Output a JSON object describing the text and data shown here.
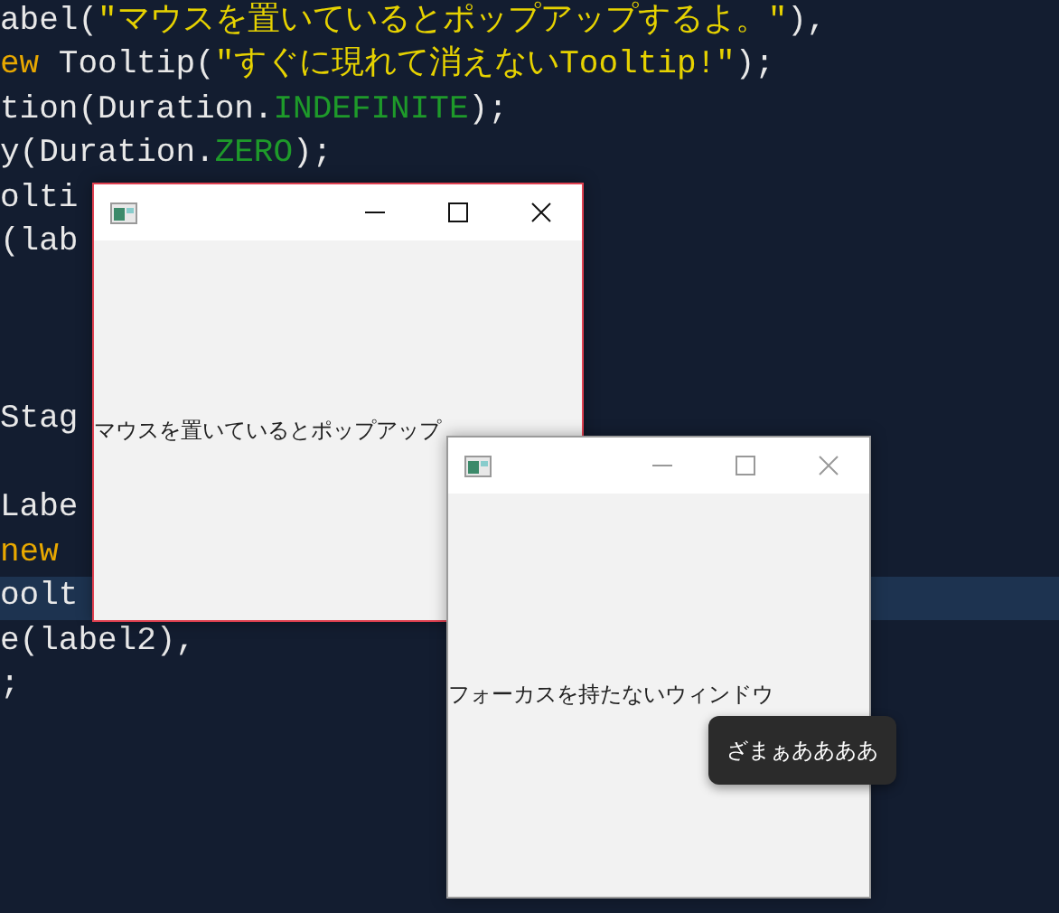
{
  "editor": {
    "lines": [
      {
        "kind": "code",
        "highlighted": false,
        "tokens": [
          {
            "text": "abel(",
            "kind": "plain"
          },
          {
            "text": "\"マウスを置いているとポップアップするよ。\"",
            "kind": "string"
          },
          {
            "text": "),",
            "kind": "plain"
          }
        ]
      },
      {
        "kind": "code",
        "highlighted": false,
        "tokens": [
          {
            "text": "ew",
            "kind": "keyword"
          },
          {
            "text": " Tooltip(",
            "kind": "plain"
          },
          {
            "text": "\"すぐに現れて消えないTooltip!\"",
            "kind": "string"
          },
          {
            "text": ");",
            "kind": "plain"
          }
        ]
      },
      {
        "kind": "code",
        "highlighted": false,
        "tokens": [
          {
            "text": "tion(Duration.",
            "kind": "plain"
          },
          {
            "text": "INDEFINITE",
            "kind": "constant"
          },
          {
            "text": ");",
            "kind": "plain"
          }
        ]
      },
      {
        "kind": "code",
        "highlighted": false,
        "tokens": [
          {
            "text": "y(Duration.",
            "kind": "plain"
          },
          {
            "text": "ZERO",
            "kind": "constant"
          },
          {
            "text": ");",
            "kind": "plain"
          }
        ]
      },
      {
        "kind": "code",
        "highlighted": false,
        "tokens": [
          {
            "text": "olti",
            "kind": "plain"
          }
        ]
      },
      {
        "kind": "code",
        "highlighted": false,
        "tokens": [
          {
            "text": "(lab",
            "kind": "plain"
          }
        ]
      },
      {
        "kind": "blank",
        "highlighted": false
      },
      {
        "kind": "blank",
        "highlighted": false
      },
      {
        "kind": "blank",
        "highlighted": false
      },
      {
        "kind": "code",
        "highlighted": false,
        "tokens": [
          {
            "text": "Stag",
            "kind": "plain"
          }
        ]
      },
      {
        "kind": "blank",
        "highlighted": false
      },
      {
        "kind": "code",
        "highlighted": false,
        "tokens": [
          {
            "text": "Labe",
            "kind": "plain"
          }
        ]
      },
      {
        "kind": "code",
        "highlighted": false,
        "tokens": [
          {
            "text": "new",
            "kind": "keyword"
          }
        ]
      },
      {
        "kind": "code",
        "highlighted": true,
        "tokens": [
          {
            "text": "oolt",
            "kind": "plain"
          }
        ]
      },
      {
        "kind": "code",
        "highlighted": false,
        "tokens": [
          {
            "text": "e(label2),",
            "kind": "plain"
          }
        ]
      },
      {
        "kind": "code",
        "highlighted": false,
        "tokens": [
          {
            "text": ";",
            "kind": "plain"
          }
        ]
      }
    ]
  },
  "windows": [
    {
      "active": true,
      "label": "マウスを置いているとポップアップ"
    },
    {
      "active": false,
      "label": "フォーカスを持たないウィンドウ"
    }
  ],
  "tooltip": {
    "text": "ざまぁああああ"
  }
}
